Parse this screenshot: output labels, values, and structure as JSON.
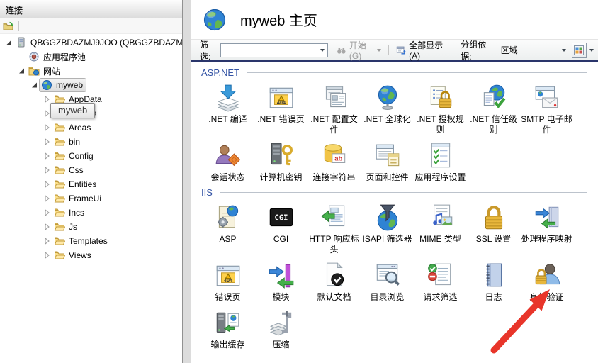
{
  "connections_panel": {
    "title": "连接",
    "tooltip": "myweb",
    "tree": [
      {
        "label": "QBGGZBDAZMJ9JOO (QBGGZBDAZM",
        "level": 0,
        "twisty": "expanded",
        "icon": "server",
        "selected": false
      },
      {
        "label": "应用程序池",
        "level": 1,
        "twisty": "none",
        "icon": "app-pools",
        "selected": false
      },
      {
        "label": "网站",
        "level": 1,
        "twisty": "expanded",
        "icon": "sites",
        "selected": false
      },
      {
        "label": "myweb",
        "level": 2,
        "twisty": "expanded",
        "icon": "site",
        "selected": true
      },
      {
        "label": "AppData",
        "level": 3,
        "twisty": "collapsed",
        "icon": "folder",
        "selected": false
      },
      {
        "label": "Plugins",
        "level": 3,
        "twisty": "collapsed",
        "icon": "folder",
        "selected": false
      },
      {
        "label": "Areas",
        "level": 3,
        "twisty": "collapsed",
        "icon": "folder",
        "selected": false
      },
      {
        "label": "bin",
        "level": 3,
        "twisty": "collapsed",
        "icon": "folder",
        "selected": false
      },
      {
        "label": "Config",
        "level": 3,
        "twisty": "collapsed",
        "icon": "folder",
        "selected": false
      },
      {
        "label": "Css",
        "level": 3,
        "twisty": "collapsed",
        "icon": "folder",
        "selected": false
      },
      {
        "label": "Entities",
        "level": 3,
        "twisty": "collapsed",
        "icon": "folder",
        "selected": false
      },
      {
        "label": "FrameUi",
        "level": 3,
        "twisty": "collapsed",
        "icon": "folder",
        "selected": false
      },
      {
        "label": "Incs",
        "level": 3,
        "twisty": "collapsed",
        "icon": "folder",
        "selected": false
      },
      {
        "label": "Js",
        "level": 3,
        "twisty": "collapsed",
        "icon": "folder",
        "selected": false
      },
      {
        "label": "Templates",
        "level": 3,
        "twisty": "collapsed",
        "icon": "folder",
        "selected": false
      },
      {
        "label": "Views",
        "level": 3,
        "twisty": "collapsed",
        "icon": "folder",
        "selected": false
      }
    ]
  },
  "main": {
    "title": "myweb 主页",
    "toolbar": {
      "filter_label": "筛选:",
      "filter_value": "",
      "go_label": "开始(G)",
      "show_all_label": "全部显示(A)",
      "group_by_label": "分组依据:",
      "group_by_value": "区域"
    },
    "sections": [
      {
        "name": "ASP.NET",
        "items": [
          {
            "label": ".NET 编译",
            "icon": "dotnet-compile"
          },
          {
            "label": ".NET 错误页",
            "icon": "dotnet-error-pages"
          },
          {
            "label": ".NET 配置文件",
            "icon": "dotnet-profile"
          },
          {
            "label": ".NET 全球化",
            "icon": "dotnet-globalization"
          },
          {
            "label": ".NET 授权规则",
            "icon": "dotnet-authorization-rules"
          },
          {
            "label": ".NET 信任级别",
            "icon": "dotnet-trust-levels"
          },
          {
            "label": "SMTP 电子邮件",
            "icon": "smtp-email"
          },
          {
            "label": "会话状态",
            "icon": "session-state"
          },
          {
            "label": "计算机密钥",
            "icon": "machine-key"
          },
          {
            "label": "连接字符串",
            "icon": "connection-strings"
          },
          {
            "label": "页面和控件",
            "icon": "pages-and-controls"
          },
          {
            "label": "应用程序设置",
            "icon": "application-settings"
          }
        ]
      },
      {
        "name": "IIS",
        "items": [
          {
            "label": "ASP",
            "icon": "asp"
          },
          {
            "label": "CGI",
            "icon": "cgi"
          },
          {
            "label": "HTTP 响应标头",
            "icon": "http-response-headers"
          },
          {
            "label": "ISAPI 筛选器",
            "icon": "isapi-filters"
          },
          {
            "label": "MIME 类型",
            "icon": "mime-types"
          },
          {
            "label": "SSL 设置",
            "icon": "ssl-settings"
          },
          {
            "label": "处理程序映射",
            "icon": "handler-mappings"
          },
          {
            "label": "错误页",
            "icon": "error-pages"
          },
          {
            "label": "模块",
            "icon": "modules"
          },
          {
            "label": "默认文档",
            "icon": "default-document"
          },
          {
            "label": "目录浏览",
            "icon": "directory-browsing"
          },
          {
            "label": "请求筛选",
            "icon": "request-filtering"
          },
          {
            "label": "日志",
            "icon": "logging"
          },
          {
            "label": "身份验证",
            "icon": "authentication"
          },
          {
            "label": "输出缓存",
            "icon": "output-caching"
          },
          {
            "label": "压缩",
            "icon": "compression"
          }
        ]
      }
    ]
  },
  "annotation": {
    "arrow_color": "#e8352a"
  }
}
